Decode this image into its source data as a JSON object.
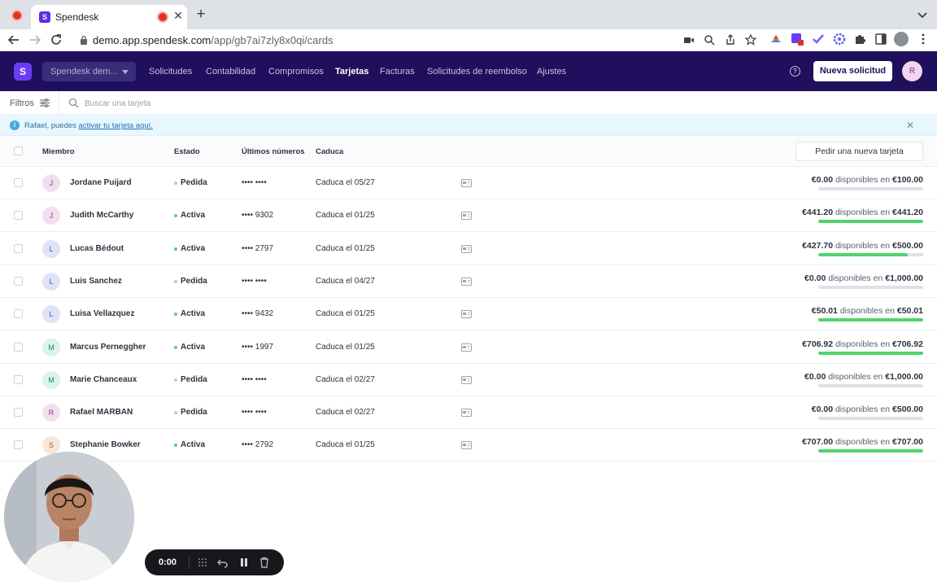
{
  "browser": {
    "tab_title": "Spendesk",
    "tab_favicon": "S",
    "url_host": "demo.app.spendesk.com",
    "url_path": "/app/gb7ai7zly8x0qi/cards"
  },
  "app": {
    "logo": "S",
    "company": "Spendesk dem...",
    "nav": [
      "Solicitudes",
      "Contabilidad",
      "Compromisos",
      "Tarjetas",
      "Facturas",
      "Solicitudes de reembolso",
      "Ajustes"
    ],
    "active_nav": "Tarjetas",
    "help_icon": "?",
    "new_request": "Nueva solicitud",
    "user_initial": "R"
  },
  "filter_bar": {
    "filters_label": "Filtros",
    "search_placeholder": "Buscar una tarjeta"
  },
  "banner": {
    "text": "Rafael, puedes ",
    "link": "activar tu tarjeta aquí."
  },
  "table": {
    "headers": {
      "member": "Miembro",
      "status": "Estado",
      "last_digits": "Últimos números",
      "expiry": "Caduca"
    },
    "order_button": "Pedir una nueva tarjeta",
    "available_word": "disponibles en",
    "status_colors": {
      "Pedida": "#c2c6cf",
      "Activa": "#4cd66b"
    },
    "rows": [
      {
        "initial": "J",
        "name": "Jordane Puijard",
        "status": "Pedida",
        "digits": "•••• ••••",
        "expiry": "Caduca el 05/27",
        "available": "€0.00",
        "limit": "€100.00",
        "fill": 0,
        "avatar_bg": "#f3def0",
        "avatar_fg": "#8a3f7f"
      },
      {
        "initial": "J",
        "name": "Judith McCarthy",
        "status": "Activa",
        "digits": "•••• 9302",
        "expiry": "Caduca el 01/25",
        "available": "€441.20",
        "limit": "€441.20",
        "fill": 1,
        "avatar_bg": "#f3def0",
        "avatar_fg": "#8a3f7f"
      },
      {
        "initial": "L",
        "name": "Lucas Bédout",
        "status": "Activa",
        "digits": "•••• 2797",
        "expiry": "Caduca el 01/25",
        "available": "€427.70",
        "limit": "€500.00",
        "fill": 0.855,
        "avatar_bg": "#dfe3f7",
        "avatar_fg": "#4a55a2"
      },
      {
        "initial": "L",
        "name": "Luis Sanchez",
        "status": "Pedida",
        "digits": "•••• ••••",
        "expiry": "Caduca el 04/27",
        "available": "€0.00",
        "limit": "€1,000.00",
        "fill": 0,
        "avatar_bg": "#dfe3f7",
        "avatar_fg": "#4a55a2"
      },
      {
        "initial": "L",
        "name": "Luisa Vellazquez",
        "status": "Activa",
        "digits": "•••• 9432",
        "expiry": "Caduca el 01/25",
        "available": "€50.01",
        "limit": "€50.01",
        "fill": 1,
        "avatar_bg": "#dfe3f7",
        "avatar_fg": "#4a55a2"
      },
      {
        "initial": "M",
        "name": "Marcus Perneggher",
        "status": "Activa",
        "digits": "•••• 1997",
        "expiry": "Caduca el 01/25",
        "available": "€706.92",
        "limit": "€706.92",
        "fill": 1,
        "avatar_bg": "#d9f3ee",
        "avatar_fg": "#2f7d6d"
      },
      {
        "initial": "M",
        "name": "Marie Chanceaux",
        "status": "Pedida",
        "digits": "•••• ••••",
        "expiry": "Caduca el 02/27",
        "available": "€0.00",
        "limit": "€1,000.00",
        "fill": 0,
        "avatar_bg": "#d9f3ee",
        "avatar_fg": "#2f7d6d"
      },
      {
        "initial": "R",
        "name": "Rafael MARBAN",
        "status": "Pedida",
        "digits": "•••• ••••",
        "expiry": "Caduca el 02/27",
        "available": "€0.00",
        "limit": "€500.00",
        "fill": 0,
        "avatar_bg": "#f3def0",
        "avatar_fg": "#8a3f7f"
      },
      {
        "initial": "S",
        "name": "Stephanie Bowker",
        "status": "Activa",
        "digits": "•••• 2792",
        "expiry": "Caduca el 01/25",
        "available": "€707.00",
        "limit": "€707.00",
        "fill": 1,
        "avatar_bg": "#f8e6d9",
        "avatar_fg": "#9a5a2e"
      }
    ]
  },
  "recorder": {
    "time": "0:00"
  }
}
